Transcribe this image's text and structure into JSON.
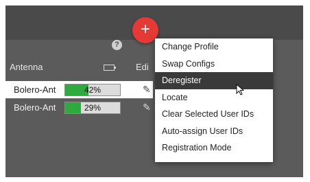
{
  "header": {
    "antenna_label": "Antenna",
    "edit_label": "Edi",
    "add_button_label": "+",
    "help_label": "?"
  },
  "rows": [
    {
      "name": "Bolero-Ant",
      "battery_text": "42%",
      "battery_pct": 42
    },
    {
      "name": "Bolero-Ant",
      "battery_text": "29%",
      "battery_pct": 29
    }
  ],
  "menu": {
    "items": [
      {
        "label": "Change Profile"
      },
      {
        "label": "Swap Configs"
      },
      {
        "label": "Deregister",
        "selected": true
      },
      {
        "label": "Locate"
      },
      {
        "label": "Clear Selected User IDs"
      },
      {
        "label": "Auto-assign User IDs"
      },
      {
        "label": "Registration Mode"
      }
    ]
  },
  "colors": {
    "background": "#5b5b5b",
    "accent_red": "#e53935",
    "battery_green": "#2eaa3f",
    "menu_selected": "#3a3a3a"
  },
  "icons": [
    "help-icon",
    "battery-icon",
    "add-icon",
    "pencil-icon",
    "cursor-icon"
  ]
}
